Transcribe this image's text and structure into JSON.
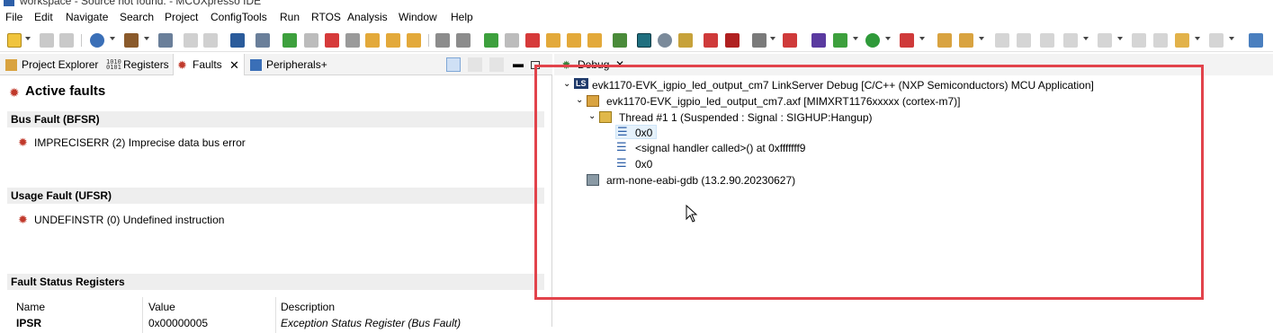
{
  "window": {
    "title": "workspace - Source not found. - MCUXpresso IDE"
  },
  "menu": [
    "File",
    "Edit",
    "Navigate",
    "Search",
    "Project",
    "ConfigTools",
    "Run",
    "RTOS",
    "Analysis",
    "Window",
    "Help"
  ],
  "left_tabs": {
    "project_explorer": "Project Explorer",
    "registers": "Registers",
    "faults": "Faults",
    "peripherals": "Peripherals+"
  },
  "faults_view": {
    "title": "Active faults",
    "bus_fault": {
      "header": "Bus Fault (BFSR)",
      "code": "IMPRECISERR",
      "count": "(2)",
      "desc": "Imprecise data bus error"
    },
    "usage_fault": {
      "header": "Usage Fault (UFSR)",
      "code": "UNDEFINSTR",
      "count": "(0)",
      "desc": "Undefined instruction"
    },
    "status_registers": {
      "header": "Fault Status Registers",
      "columns": [
        "Name",
        "Value",
        "Description"
      ],
      "rows": [
        {
          "name": "IPSR",
          "value": "0x00000005",
          "desc": "Exception Status Register (Bus Fault)"
        }
      ]
    }
  },
  "debug_view": {
    "tab": "Debug",
    "launch": "evk1170-EVK_igpio_led_output_cm7 LinkServer Debug [C/C++ (NXP Semiconductors) MCU Application]",
    "process": "evk1170-EVK_igpio_led_output_cm7.axf [MIMXRT1176xxxxx (cortex-m7)]",
    "thread": "Thread #1 1 (Suspended : Signal : SIGHUP:Hangup)",
    "frames": [
      "0x0",
      "<signal handler called>() at 0xfffffff9",
      "0x0"
    ],
    "gdb": "arm-none-eabi-gdb (13.2.90.20230627)"
  },
  "colors": {
    "highlight": "#e2434b",
    "bug": "#c0392b",
    "selection": "#e5f1fb"
  }
}
